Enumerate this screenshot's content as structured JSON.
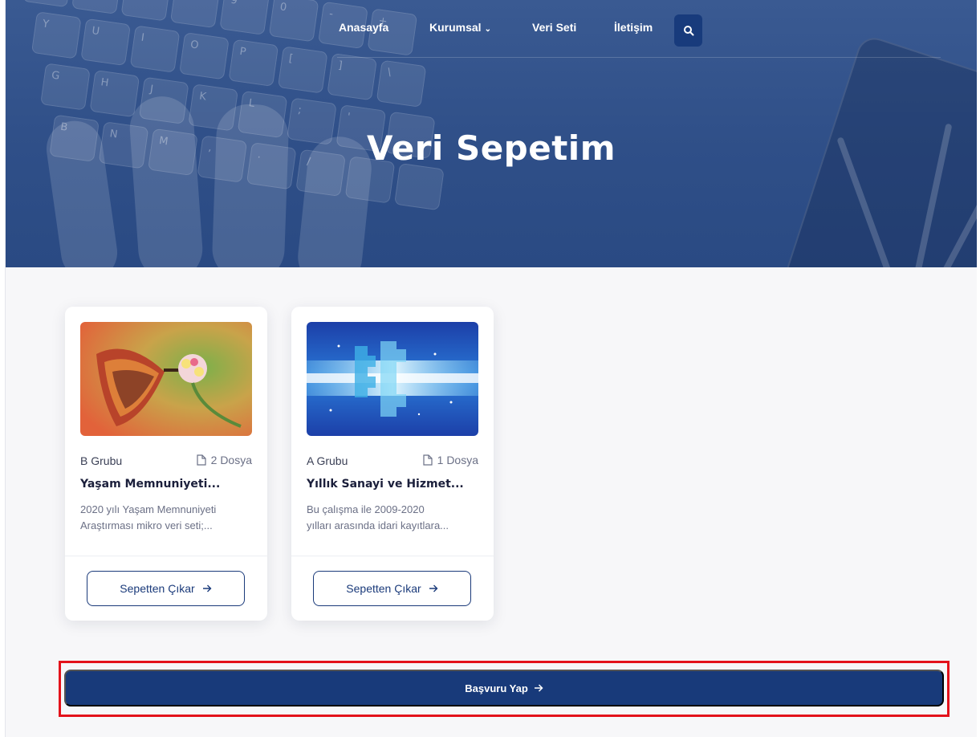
{
  "nav": {
    "items": [
      "Anasayfa",
      "Kurumsal",
      "Veri Seti",
      "İletişim"
    ]
  },
  "hero": {
    "title": "Veri Sepetim"
  },
  "cards": [
    {
      "group": "B Grubu",
      "files": "2 Dosya",
      "title": "Yaşam Memnuniyeti...",
      "desc_line1": "2020 yılı Yaşam Memnuniyeti",
      "desc_line2": "Araştırması mikro veri seti;...",
      "button": "Sepetten Çıkar"
    },
    {
      "group": "A Grubu",
      "files": "1 Dosya",
      "title": "Yıllık Sanayi ve Hizmet...",
      "desc_line1": "Bu çalışma ile 2009-2020",
      "desc_line2": "yılları arasında idari kayıtlara...",
      "button": "Sepetten Çıkar"
    }
  ],
  "apply": {
    "label": "Başvuru Yap"
  },
  "colors": {
    "primary": "#183a7a",
    "hero": "#2f4f88",
    "highlight": "#e3121b"
  },
  "icons": {
    "search": "search-icon",
    "chevron": "chevron-down-icon",
    "file": "file-icon",
    "arrow": "arrow-right-icon"
  }
}
